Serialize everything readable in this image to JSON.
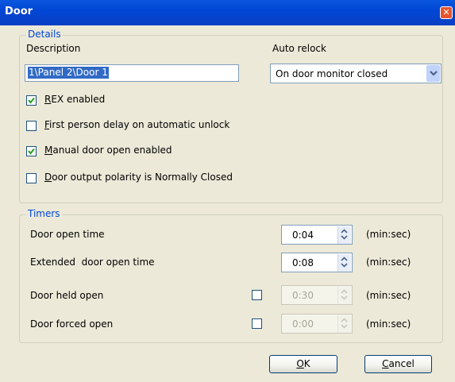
{
  "window": {
    "title": "Door",
    "close_glyph": "✕"
  },
  "details": {
    "legend": "Details",
    "description_label": "Description",
    "description_value": "1\\Panel 2\\Door 1",
    "autorelock_label": "Auto relock",
    "autorelock_value": "On door monitor closed",
    "checkboxes": [
      {
        "label": "REX enabled",
        "accel": "R",
        "rest": "EX enabled",
        "checked": true
      },
      {
        "label": "First person delay on automatic unlock",
        "accel": "F",
        "rest": "irst person delay on automatic unlock",
        "checked": false
      },
      {
        "label": "Manual door open enabled",
        "accel": "M",
        "rest": "anual door open enabled",
        "checked": true
      },
      {
        "label": "Door output polarity is Normally Closed",
        "accel": "D",
        "rest": "oor output polarity is Normally Closed",
        "checked": false
      }
    ]
  },
  "timers": {
    "legend": "Timers",
    "rows": [
      {
        "label": "Door open time",
        "value": "0:04",
        "unit": "(min:sec)",
        "enabled": true
      },
      {
        "label": "Extended  door open time",
        "value": "0:08",
        "unit": "(min:sec)",
        "enabled": true
      },
      {
        "label": "Door held open",
        "value": "0:30",
        "unit": "(min:sec)",
        "enabled": false
      },
      {
        "label": "Door forced open",
        "value": "0:00",
        "unit": "(min:sec)",
        "enabled": false
      }
    ]
  },
  "buttons": {
    "ok": "OK",
    "ok_accel": "O",
    "ok_rest": "K",
    "cancel": "Cancel",
    "cancel_accel": "C",
    "cancel_rest": "ancel"
  },
  "colors": {
    "titlebar": "#0046d5",
    "legend": "#0046d5",
    "selection": "#316ac5",
    "check": "#21a121"
  }
}
